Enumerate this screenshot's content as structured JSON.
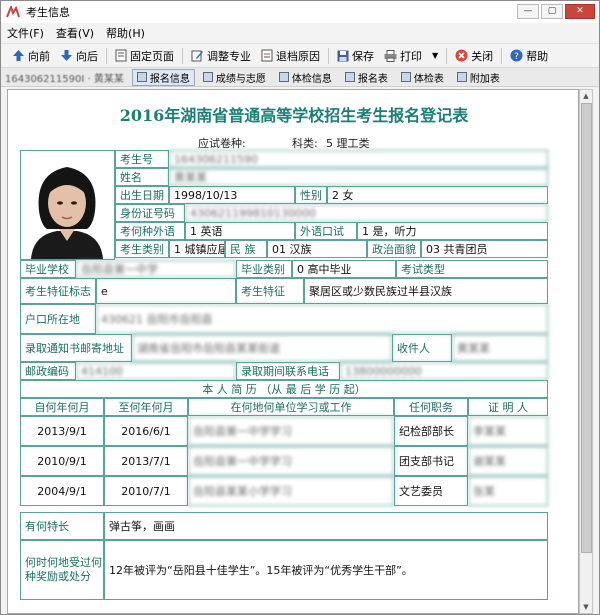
{
  "window": {
    "title": "考生信息",
    "accent": "#c9463d"
  },
  "menu": [
    "文件(F)",
    "查看(V)",
    "帮助(H)"
  ],
  "toolbar": {
    "back": "向前",
    "forward": "向后",
    "fix_page": "固定页面",
    "adjust_major": "调整专业",
    "withdraw_reason": "退档原因",
    "save": "保存",
    "print": "打印",
    "close": "关闭",
    "help": "帮助"
  },
  "tabs": {
    "user_id": "164306211590I · 黄某某",
    "items": [
      "报名信息",
      "成绩与志愿",
      "体检信息",
      "报名表",
      "体检表",
      "附加表"
    ],
    "active": "报名信息"
  },
  "doc": {
    "title": "2016年湖南省普通高等学校招生考生报名登记表",
    "paper_type_label": "应试卷种:",
    "subject_label": "科类:",
    "subject_value": "5 理工类",
    "accent_color": "#1c7f76"
  },
  "form": {
    "exam_no_label": "考生号",
    "exam_no_value": "164306211590",
    "name_label": "姓名",
    "name_value": "黄某某",
    "birth_label": "出生日期",
    "birth_value": "1998/10/13",
    "gender_label": "性别",
    "gender_value": "2 女",
    "id_label": "身份证号码",
    "id_value": "430621199810130000",
    "lang_label": "考何种外语",
    "lang_value": "1 英语",
    "oral_label": "外语口试",
    "oral_value": "1 是，听力",
    "category_label": "考生类别",
    "category_value": "1 城镇应届",
    "ethnic_label": "民 族",
    "ethnic_value": "01 汉族",
    "political_label": "政治面貌",
    "political_value": "03 共青团员",
    "school_label": "毕业学校",
    "school_value": "岳阳县第一中学",
    "grad_type_label": "毕业类别",
    "grad_type_value": "0 高中毕业",
    "exam_type_label": "考试类型",
    "mark_label": "考生特征标志",
    "mark_value": "e",
    "feature_label": "考生特征",
    "feature_value": "聚居区或少数民族过半县汉族",
    "hukou_label": "户口所在地",
    "hukou_value": "430621 岳阳市岳阳县",
    "address_label": "录取通知书邮寄地址",
    "address_value": "湖南省岳阳市岳阳县某某街道",
    "receiver_label": "收件人",
    "receiver_value": "黄某某",
    "postcode_label": "邮政编码",
    "postcode_value": "414100",
    "phone_label": "录取期间联系电话",
    "phone_value": "13800000000",
    "resume_title": "本 人 简 历 （从 最 后 学 历 起）",
    "resume_headers": [
      "自何年何月",
      "至何年何月",
      "在何地何单位学习或工作",
      "任何职务",
      "证 明 人"
    ],
    "resume_rows": [
      {
        "from": "2013/9/1",
        "to": "2016/6/1",
        "unit": "岳阳县第一中学学习",
        "role": "纪检部部长",
        "witness": "李某某"
      },
      {
        "from": "2010/9/1",
        "to": "2013/7/1",
        "unit": "岳阳县第一中学学习",
        "role": "团支部书记",
        "witness": "谢某某"
      },
      {
        "from": "2004/9/1",
        "to": "2010/7/1",
        "unit": "岳阳县某某小学学习",
        "role": "文艺委员",
        "witness": "张某"
      }
    ],
    "talent_label": "有何特长",
    "talent_value": "弹古筝，画画",
    "award_label": "何时何地受过何种奖励或处分",
    "award_value": "12年被评为“岳阳县十佳学生”。15年被评为“优秀学生干部”。"
  }
}
